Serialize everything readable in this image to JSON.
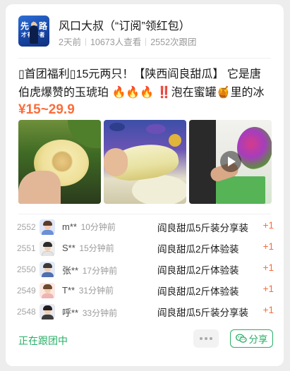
{
  "header": {
    "avatar_text_line1": "先上路",
    "avatar_text_line2": "才有行者",
    "title": "风口大叔（“订阅”领红包）",
    "meta": {
      "posted": "2天前",
      "views": "10673人查看",
      "follows": "2552次跟团"
    }
  },
  "post": {
    "description": "▯首团福利▯15元两只！【陕西阎良甜瓜】 它是唐伯虎爆赞的玉琥珀 🔥🔥🔥 ‼️泡在蜜罐🍯里的冰淇…",
    "price": "¥15~29.9",
    "photos": [
      {
        "icon": "melon-photo"
      },
      {
        "icon": "melon-slice-photo"
      },
      {
        "icon": "video-thumbnail",
        "has_play": true
      }
    ]
  },
  "follow_list": [
    {
      "num": "2552",
      "name": "m**",
      "time": "10分钟前",
      "item": "阎良甜瓜5斤装分享装",
      "qty": "+1",
      "hair": "#5a3a2a",
      "body": "#6c8fd6"
    },
    {
      "num": "2551",
      "name": "S**",
      "time": "15分钟前",
      "item": "阎良甜瓜2斤体验装",
      "qty": "+1",
      "hair": "#2b2b2b",
      "body": "#e4e4e4"
    },
    {
      "num": "2550",
      "name": "张**",
      "time": "17分钟前",
      "item": "阎良甜瓜2斤体验装",
      "qty": "+1",
      "hair": "#3a3a3a",
      "body": "#4f6fb0"
    },
    {
      "num": "2549",
      "name": "T**",
      "time": "31分钟前",
      "item": "阎良甜瓜2斤体验装",
      "qty": "+1",
      "hair": "#6b4a2e",
      "body": "#f0b3b3"
    },
    {
      "num": "2548",
      "name": "呼**",
      "time": "33分钟前",
      "item": "阎良甜瓜5斤装分享装",
      "qty": "+1",
      "hair": "#1f1f1f",
      "body": "#3d3d3d"
    }
  ],
  "footer": {
    "status": "正在跟团中",
    "share_label": "分享"
  },
  "colors": {
    "accent_green": "#2aae67",
    "price_orange": "#fa6d3a"
  }
}
